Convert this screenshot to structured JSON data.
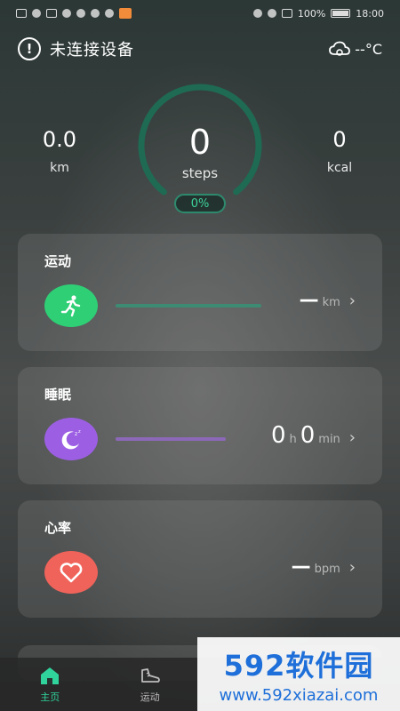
{
  "status_bar": {
    "battery_text": "100%",
    "time": "18:00"
  },
  "header": {
    "device_status": "未连接设备",
    "temperature": "--°C"
  },
  "stats": {
    "distance_value": "0.0",
    "distance_unit": "km",
    "steps_value": "0",
    "steps_unit": "steps",
    "calorie_value": "0",
    "calorie_unit": "kcal",
    "progress_label": "0%",
    "progress_fraction": 0
  },
  "cards": {
    "sport": {
      "title": "运动",
      "value": "—",
      "unit": "km",
      "color": "#2fcf76"
    },
    "sleep": {
      "title": "睡眠",
      "hours": "0",
      "hours_unit": "h",
      "minutes": "0",
      "minutes_unit": "min",
      "color": "#9c5fe4"
    },
    "heart": {
      "title": "心率",
      "value": "—",
      "unit": "bpm",
      "color": "#f0635a"
    }
  },
  "bottom_nav": {
    "items": [
      {
        "label": "主页",
        "active": true
      },
      {
        "label": "运动",
        "active": false
      }
    ]
  },
  "watermark": {
    "brand": "592软件园",
    "url": "www.592xiazai.com"
  },
  "colors": {
    "accent": "#2fd39b",
    "ring_track": "#1f6a52"
  }
}
